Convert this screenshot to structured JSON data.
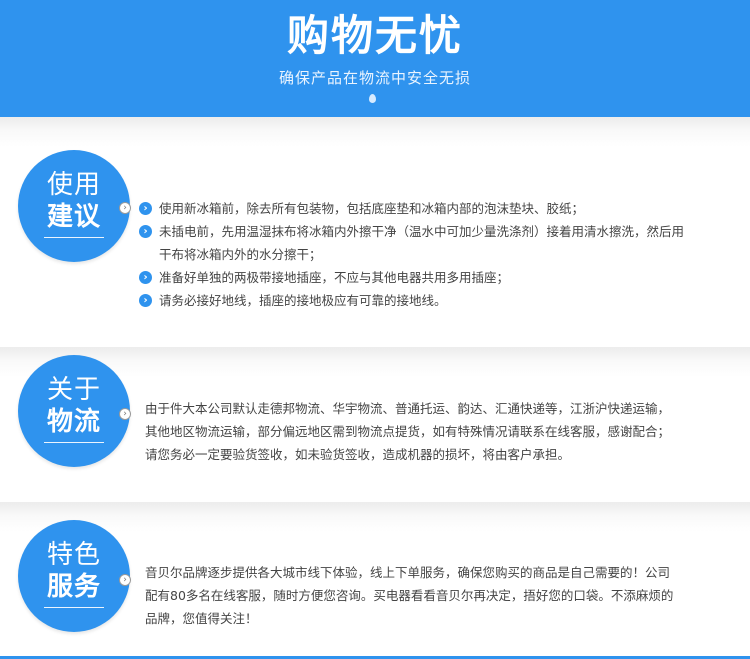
{
  "header": {
    "title": "购物无忧",
    "subtitle": "确保产品在物流中安全无损"
  },
  "sections": [
    {
      "badge_line1": "使用",
      "badge_line2": "建议",
      "items": [
        "使用新冰箱前，除去所有包装物，包括底座垫和冰箱内部的泡沫垫块、胶纸；",
        "未插电前，先用温湿抹布将冰箱内外擦干净（温水中可加少量洗涤剂）接着用清水擦洗，然后用",
        "干布将冰箱内外的水分擦干；",
        "准备好单独的两极带接地插座，不应与其他电器共用多用插座；",
        "请务必接好地线，插座的接地极应有可靠的接地线。"
      ]
    },
    {
      "badge_line1": "关于",
      "badge_line2": "物流",
      "lines": [
        "由于件大本公司默认走德邦物流、华宇物流、普通托运、韵达、汇通快递等，江浙沪快递运输，",
        "其他地区物流运输，部分偏远地区需到物流点提货，如有特殊情况请联系在线客服，感谢配合；",
        "请您务必一定要验货签收，如未验货签收，造成机器的损坏，将由客户承担。"
      ]
    },
    {
      "badge_line1": "特色",
      "badge_line2": "服务",
      "lines": [
        "音贝尔品牌逐步提供各大城市线下体验，线上下单服务，确保您购买的商品是自己需要的！公司",
        "配有80多名在线客服，随时方便您咨询。买电器看看音贝尔再决定，捂好您的口袋。不添麻烦的",
        "品牌，您值得关注！"
      ]
    }
  ],
  "colors": {
    "accent": "#2f93ee",
    "text": "#444444"
  },
  "icons": {
    "pointer": "chevron-right-icon",
    "bullet": "arrow-right-bullet-icon"
  }
}
